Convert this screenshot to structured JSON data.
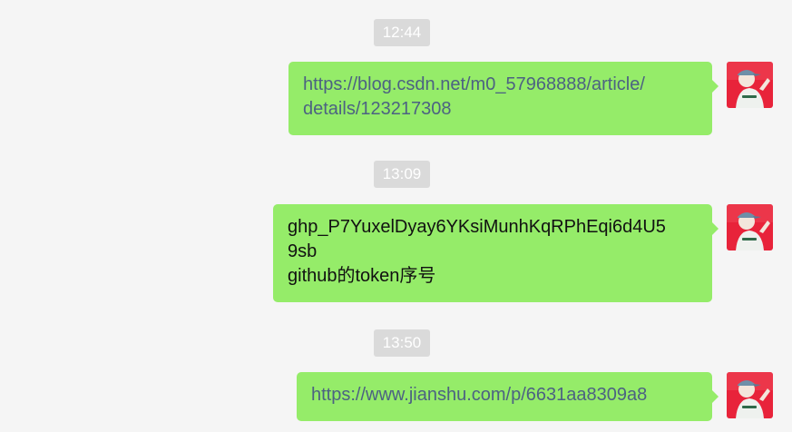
{
  "messages": [
    {
      "time": "12:44",
      "type": "link",
      "text": "https://blog.csdn.net/m0_57968888/article/\ndetails/123217308"
    },
    {
      "time": "13:09",
      "type": "text",
      "text": "ghp_P7YuxelDyay6YKsiMunhKqRPhEqi6d4U5\n9sb\ngithub的token序号"
    },
    {
      "time": "13:50",
      "type": "link",
      "text": "https://www.jianshu.com/p/6631aa8309a8"
    }
  ],
  "avatar": {
    "icon": "user-avatar-icon",
    "background": "#e8233a"
  },
  "colors": {
    "bubble": "#95ec69",
    "link": "#4c6282",
    "timestamp_bg": "#dadada",
    "background": "#f5f5f5"
  }
}
